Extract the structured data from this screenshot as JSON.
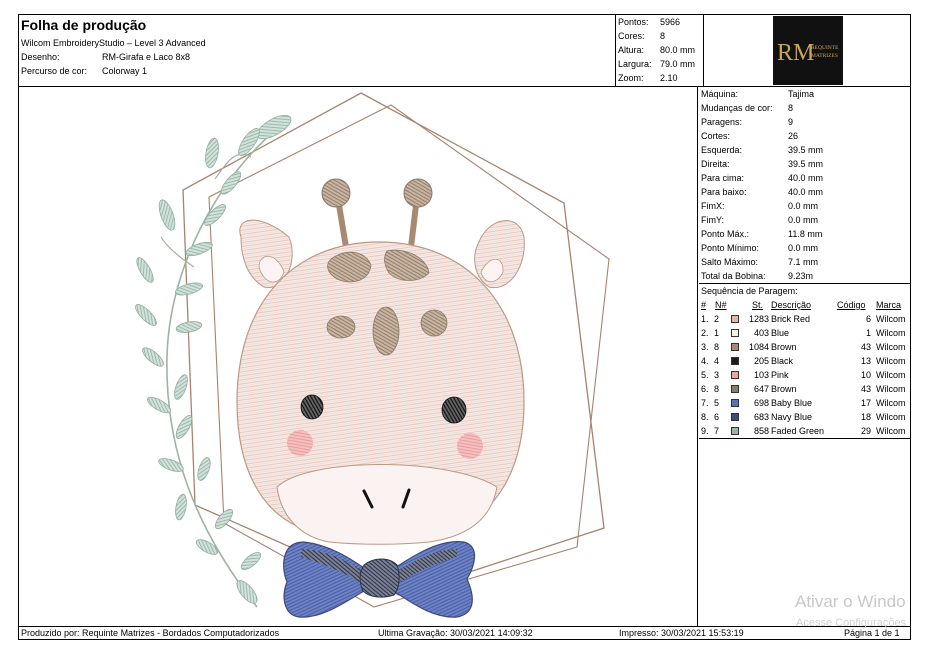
{
  "header": {
    "title": "Folha de produção",
    "software": "Wilcom EmbroideryStudio – Level 3 Advanced",
    "design_label": "Desenho:",
    "design_value": "RM-Girafa e Laco 8x8",
    "colorway_label": "Percurso de cor:",
    "colorway_value": "Colorway 1"
  },
  "stats": {
    "stitches_label": "Pontos:",
    "stitches": "5966",
    "colors_label": "Cores:",
    "colors": "8",
    "height_label": "Altura:",
    "height": "80.0 mm",
    "width_label": "Largura:",
    "width": "79.0 mm",
    "zoom_label": "Zoom:",
    "zoom": "2.10"
  },
  "logo": {
    "monogram": "RM",
    "line1": "REQUINTE",
    "line2": "MATRIZES"
  },
  "machine": [
    {
      "label": "Máquina:",
      "value": "Tajima"
    },
    {
      "label": "Mudanças de cor:",
      "value": "8"
    },
    {
      "label": "Paragens:",
      "value": "9"
    },
    {
      "label": "Cortes:",
      "value": "26"
    },
    {
      "label": "Esquerda:",
      "value": "39.5 mm"
    },
    {
      "label": "Direita:",
      "value": "39.5 mm"
    },
    {
      "label": "Para cima:",
      "value": "40.0 mm"
    },
    {
      "label": "Para baixo:",
      "value": "40.0 mm"
    },
    {
      "label": "FimX:",
      "value": "0.0 mm"
    },
    {
      "label": "FimY:",
      "value": "0.0 mm"
    },
    {
      "label": "Ponto Máx.:",
      "value": "11.8 mm"
    },
    {
      "label": "Ponto Mínimo:",
      "value": "0.0 mm"
    },
    {
      "label": "Salto Máximo:",
      "value": "7.1 mm"
    },
    {
      "label": "Total da Bobina:",
      "value": "9.23m"
    }
  ],
  "sequence": {
    "title": "Sequência de Paragem:",
    "columns": {
      "hash": "#",
      "n": "N#",
      "st": "St.",
      "desc": "Descrição",
      "code": "Código",
      "brand": "Marca"
    },
    "rows": [
      {
        "idx": "1.",
        "n": "2",
        "color": "#e8b4a4",
        "st": "1283",
        "desc": "Brick Red",
        "code": "6",
        "brand": "Wilcom"
      },
      {
        "idx": "2.",
        "n": "1",
        "color": "#f4f1ea",
        "st": "403",
        "desc": "Blue",
        "code": "1",
        "brand": "Wilcom"
      },
      {
        "idx": "3.",
        "n": "8",
        "color": "#a88a72",
        "st": "1084",
        "desc": "Brown",
        "code": "43",
        "brand": "Wilcom"
      },
      {
        "idx": "4.",
        "n": "4",
        "color": "#1c1c1c",
        "st": "205",
        "desc": "Black",
        "code": "13",
        "brand": "Wilcom"
      },
      {
        "idx": "5.",
        "n": "3",
        "color": "#f0a4a4",
        "st": "103",
        "desc": "Pink",
        "code": "10",
        "brand": "Wilcom"
      },
      {
        "idx": "6.",
        "n": "8",
        "color": "#8a7a68",
        "st": "647",
        "desc": "Brown",
        "code": "43",
        "brand": "Wilcom"
      },
      {
        "idx": "7.",
        "n": "5",
        "color": "#5a70b8",
        "st": "698",
        "desc": "Baby Blue",
        "code": "17",
        "brand": "Wilcom"
      },
      {
        "idx": "8.",
        "n": "6",
        "color": "#3e4a78",
        "st": "683",
        "desc": "Navy Blue",
        "code": "18",
        "brand": "Wilcom"
      },
      {
        "idx": "9.",
        "n": "7",
        "color": "#9cb4a4",
        "st": "858",
        "desc": "Faded Green",
        "code": "29",
        "brand": "Wilcom"
      }
    ]
  },
  "footer": {
    "produced": "Produzido por: Requinte Matrizes - Bordados Computadorizados",
    "saved": "Ultima Gravação: 30/03/2021 14:09:32",
    "printed": "Impresso: 30/03/2021 15:53:19",
    "page": "Página 1 de 1"
  },
  "watermark": {
    "line1": "Ativar o Windo",
    "line2": "Acesse Configurações"
  }
}
